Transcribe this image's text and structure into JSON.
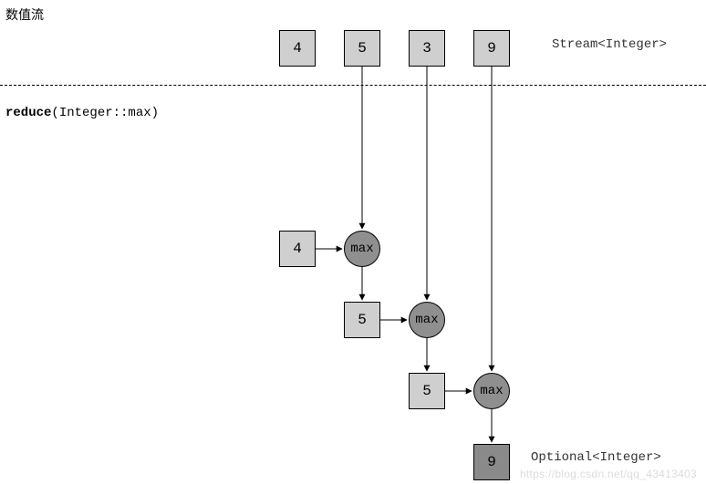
{
  "title": "数值流",
  "method": {
    "name": "reduce",
    "arg": "(Integer::max)"
  },
  "type_labels": {
    "input": "Stream<Integer>",
    "output": "Optional<Integer>"
  },
  "op_label": "max",
  "stream_values": [
    "4",
    "5",
    "3",
    "9"
  ],
  "steps": [
    {
      "acc_in": "4",
      "acc_out": "5"
    },
    {
      "acc_in": "5",
      "acc_out": "5"
    },
    {
      "acc_in": "5",
      "acc_out": "9"
    }
  ],
  "result": "9",
  "watermark": "https://blog.csdn.net/qq_43413403"
}
